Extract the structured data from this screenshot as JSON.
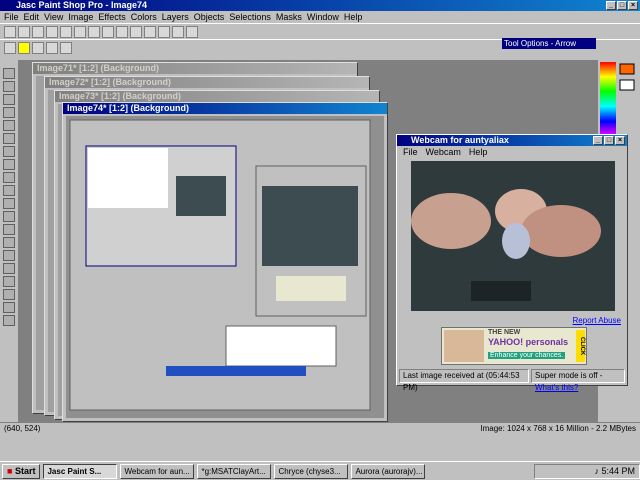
{
  "app": {
    "title": "Jasc Paint Shop Pro - Image74",
    "menu": [
      "File",
      "Edit",
      "View",
      "Image",
      "Effects",
      "Colors",
      "Layers",
      "Objects",
      "Selections",
      "Masks",
      "Window",
      "Help"
    ],
    "tool_options_title": "Tool Options - Arrow",
    "status_left": "(640, 524)",
    "status_right": "Image:  1024 x 768 x 16 Million - 2.2 MBytes"
  },
  "child_windows": [
    {
      "title": "Image71* [1:2] (Background)"
    },
    {
      "title": "Image72* [1:2] (Background)"
    },
    {
      "title": "Image73* [1:2] (Background)"
    },
    {
      "title": "Image74* [1:2] (Background)"
    }
  ],
  "webcam": {
    "title": "Webcam for auntyaliax",
    "menu": [
      "File",
      "Webcam",
      "Help"
    ],
    "ad_line1": "THE NEW",
    "ad_brand": "YAHOO! personals",
    "ad_tagline": "Enhance your chances.",
    "ad_click": "CLICK",
    "report_abuse": "Report Abuse",
    "last_image": "Last image received at (05:44:53 PM)",
    "super_mode": "Super mode is off - ",
    "whats_this": "What's this?"
  },
  "taskbar": {
    "start": "Start",
    "tasks": [
      {
        "label": "Jasc Paint S...",
        "active": true
      },
      {
        "label": "Webcam for aun...",
        "active": false
      },
      {
        "label": "*g:MSATClayArt...",
        "active": false
      },
      {
        "label": "Chryce (chyse3...",
        "active": false
      },
      {
        "label": "Aurora (aurorajv)...",
        "active": false
      }
    ],
    "clock": "5:44 PM"
  }
}
